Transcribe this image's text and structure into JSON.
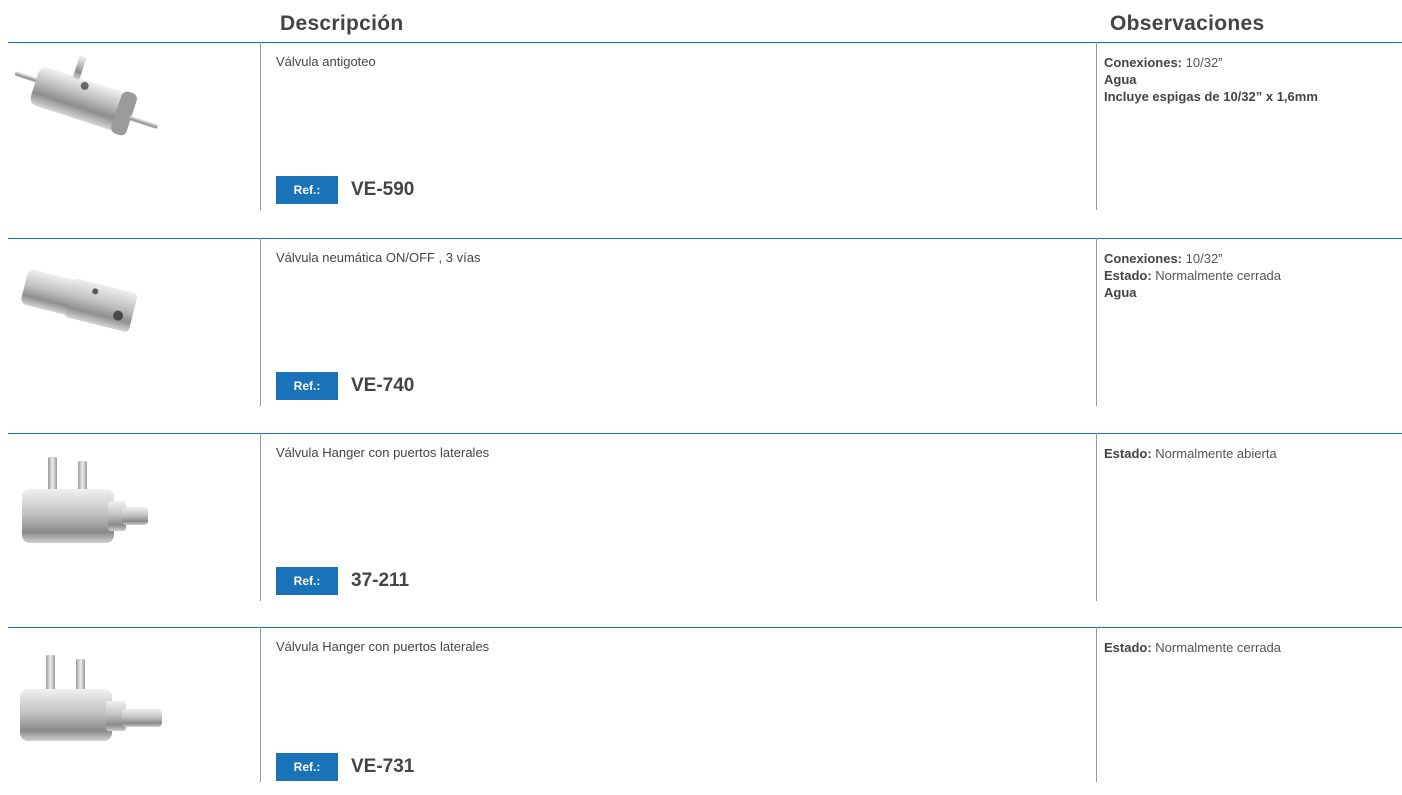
{
  "headers": {
    "descripcion": "Descripción",
    "observaciones": "Observaciones"
  },
  "ref_label": "Ref.:",
  "products": [
    {
      "description": "Válvula antigoteo",
      "ref": "VE-590",
      "image": "valve-antigoteo",
      "obs": [
        {
          "label": "Conexiones:",
          "value": "10/32”"
        },
        {
          "label": "Agua",
          "value": ""
        },
        {
          "label": "Incluye espigas de 10/32” x 1,6mm",
          "value": ""
        }
      ]
    },
    {
      "description": "Válvula neumática ON/OFF , 3 vías",
      "ref": "VE-740",
      "image": "valve-neumatica",
      "obs": [
        {
          "label": "Conexiones:",
          "value": "10/32”"
        },
        {
          "label": "Estado:",
          "value": "Normalmente cerrada"
        },
        {
          "label": "Agua",
          "value": ""
        }
      ]
    },
    {
      "description": "Válvula Hanger con puertos laterales",
      "ref": "37-211",
      "image": "valve-hanger",
      "obs": [
        {
          "label": "Estado:",
          "value": "Normalmente abierta"
        }
      ]
    },
    {
      "description": "Válvula Hanger con puertos laterales",
      "ref": "VE-731",
      "image": "valve-hanger",
      "obs": [
        {
          "label": "Estado:",
          "value": "Normalmente cerrada"
        }
      ]
    }
  ],
  "colors": {
    "accent": "#1a72b8",
    "text": "#444444"
  }
}
